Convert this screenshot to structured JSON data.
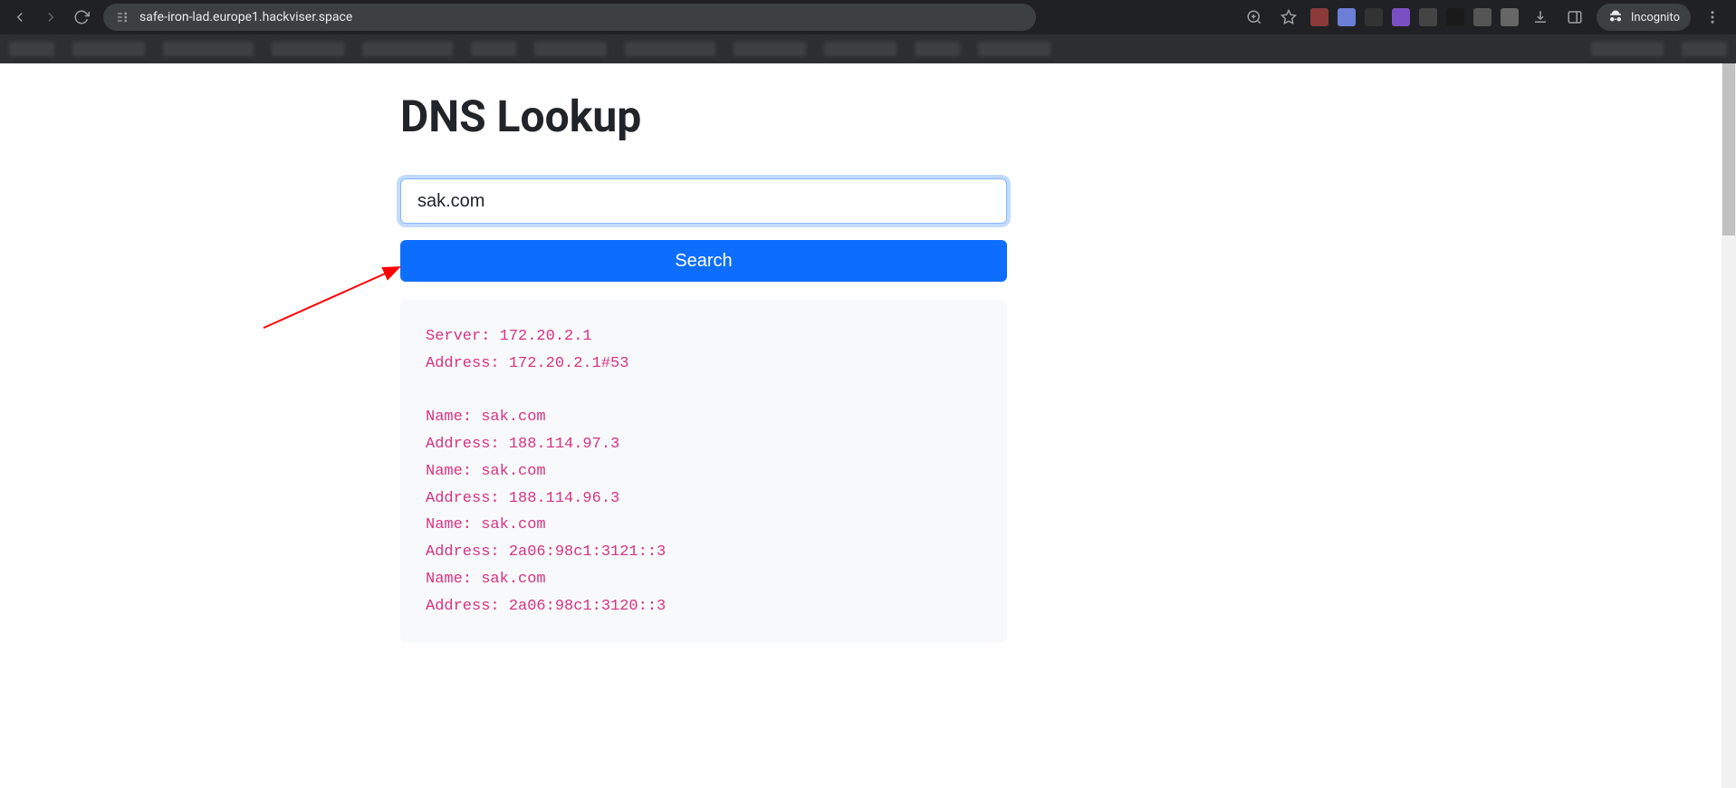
{
  "browser": {
    "url": "safe-iron-lad.europe1.hackviser.space",
    "incognito_label": "Incognito"
  },
  "page": {
    "title": "DNS Lookup",
    "input_value": "sak.com",
    "search_button_label": "Search",
    "output_lines": [
      "Server: 172.20.2.1",
      "Address: 172.20.2.1#53",
      "",
      "Name: sak.com",
      "Address: 188.114.97.3",
      "Name: sak.com",
      "Address: 188.114.96.3",
      "Name: sak.com",
      "Address: 2a06:98c1:3121::3",
      "Name: sak.com",
      "Address: 2a06:98c1:3120::3"
    ]
  }
}
